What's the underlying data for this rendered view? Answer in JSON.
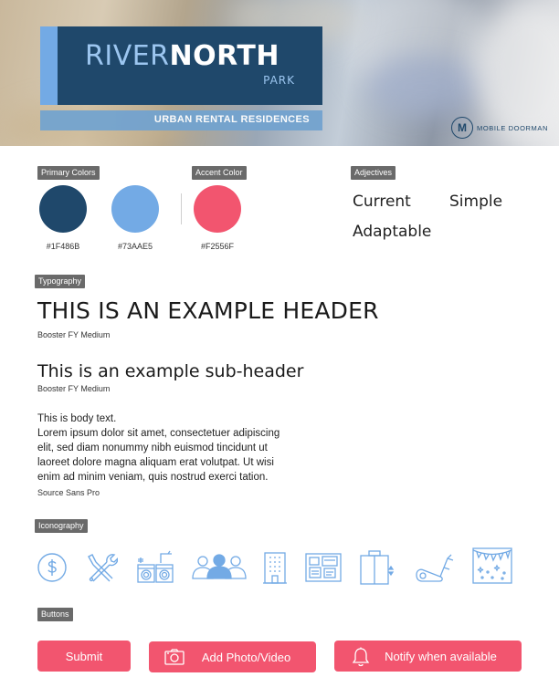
{
  "brand": {
    "name_light": "RIVER",
    "name_bold": "NORTH",
    "suffix": "PARK",
    "tagline": "URBAN RENTAL RESIDENCES",
    "partner_initial": "M",
    "partner_name": "MOBILE DOORMAN"
  },
  "sections": {
    "primary_colors": "Primary Colors",
    "accent_color": "Accent Color",
    "adjectives": "Adjectives",
    "typography": "Typography",
    "iconography": "Iconography",
    "buttons": "Buttons"
  },
  "colors": {
    "primary": [
      {
        "hex": "#1F486B",
        "label": "#1F486B"
      },
      {
        "hex": "#73AAE5",
        "label": "#73AAE5"
      }
    ],
    "accent": {
      "hex": "#F2556F",
      "label": "#F2556F"
    }
  },
  "adjectives": [
    "Current",
    "Simple",
    "Adaptable"
  ],
  "typography": {
    "header": "THIS IS AN EXAMPLE HEADER",
    "header_font": "Booster FY Medium",
    "subheader": "This is an example sub-header",
    "subheader_font": "Booster FY Medium",
    "body_lines": [
      "This is body text.",
      "Lorem ipsum dolor sit amet, consectetuer adipiscing",
      "elit, sed diam nonummy nibh euismod tincidunt ut",
      "laoreet dolore magna aliquam erat volutpat. Ut wisi",
      "enim ad minim veniam, quis nostrud exerci tation."
    ],
    "body_font": "Source Sans Pro"
  },
  "icons": [
    "dollar-icon",
    "tools-icon",
    "laundry-icon",
    "community-icon",
    "building-icon",
    "bulletin-board-icon",
    "elevator-icon",
    "fitness-icon",
    "party-icon"
  ],
  "buttons": {
    "submit": "Submit",
    "add_photo": "Add Photo/Video",
    "notify": "Notify when available"
  },
  "icon_color": "#73AAE5"
}
